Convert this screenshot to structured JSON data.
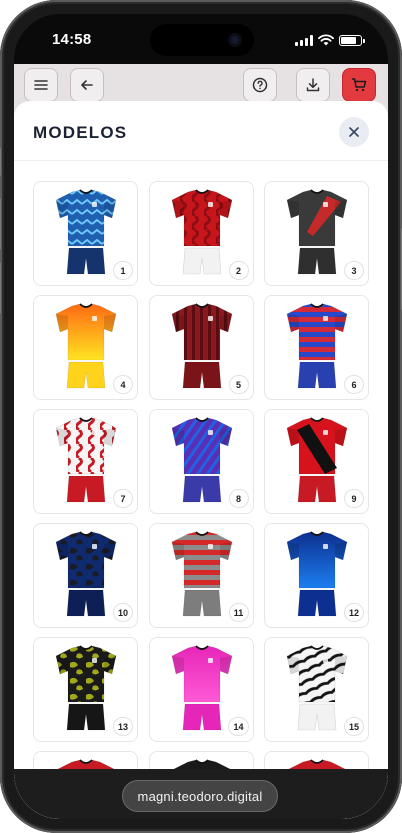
{
  "status": {
    "time": "14:58"
  },
  "toolbar": {
    "menu_icon": "hamburger-icon",
    "back_icon": "arrow-left-icon",
    "help_icon": "question-circle-icon",
    "download_icon": "download-icon",
    "cart_icon": "cart-icon",
    "cart_color": "#e23a3e"
  },
  "sheet": {
    "title": "MODELOS",
    "close_icon": "close-icon"
  },
  "models": [
    {
      "number": "1",
      "style": "zigzag",
      "c1": "#1f5fb0",
      "c2": "#6ec8ff",
      "shorts": "#15346e"
    },
    {
      "number": "2",
      "style": "wave",
      "c1": "#c8151b",
      "c2": "#8e0d12",
      "shorts": "#f2f2f2"
    },
    {
      "number": "3",
      "style": "slash",
      "c1": "#3a3a3a",
      "c2": "#d62828",
      "shorts": "#2f2f2f"
    },
    {
      "number": "4",
      "style": "gradient",
      "c1": "#ff6a13",
      "c2": "#ffe422",
      "shorts": "#ffd21c"
    },
    {
      "number": "5",
      "style": "stripes",
      "c1": "#8a1a1f",
      "c2": "#5a0c10",
      "shorts": "#7a1418"
    },
    {
      "number": "6",
      "style": "hoops",
      "c1": "#d42b3a",
      "c2": "#2948c9",
      "shorts": "#2940b0"
    },
    {
      "number": "7",
      "style": "wave",
      "c1": "#f5f5f5",
      "c2": "#c81a24",
      "shorts": "#c81a24"
    },
    {
      "number": "8",
      "style": "diagonal",
      "c1": "#5a2fb4",
      "c2": "#1e63e6",
      "shorts": "#3a3aa8"
    },
    {
      "number": "9",
      "style": "sash",
      "c1": "#d6131c",
      "c2": "#111111",
      "shorts": "#c81a24"
    },
    {
      "number": "10",
      "style": "camo",
      "c1": "#0f2a6e",
      "c2": "#1a1a1a",
      "shorts": "#0d1f55"
    },
    {
      "number": "11",
      "style": "hoops",
      "c1": "#8c8c8c",
      "c2": "#d62828",
      "shorts": "#7d7d7d"
    },
    {
      "number": "12",
      "style": "gradient",
      "c1": "#0d2f8f",
      "c2": "#1c7ef0",
      "shorts": "#0d2f8f"
    },
    {
      "number": "13",
      "style": "camo",
      "c1": "#1a1a1a",
      "c2": "#b9c21a",
      "shorts": "#161616"
    },
    {
      "number": "14",
      "style": "gradient",
      "c1": "#e626b8",
      "c2": "#ff5ad6",
      "shorts": "#e626b8"
    },
    {
      "number": "15",
      "style": "zebra",
      "c1": "#f5f5f5",
      "c2": "#141414",
      "shorts": "#f2f2f2"
    },
    {
      "number": "",
      "style": "plain",
      "c1": "#c81a24",
      "c2": "#1a1a1a",
      "shorts": "#1a1a1a"
    },
    {
      "number": "",
      "style": "plain",
      "c1": "#1a1a1a",
      "c2": "#444444",
      "shorts": "#1a1a1a"
    },
    {
      "number": "",
      "style": "plain",
      "c1": "#c81a24",
      "c2": "#9a1016",
      "shorts": "#c81a24"
    }
  ],
  "browser": {
    "url": "magni.teodoro.digital"
  }
}
